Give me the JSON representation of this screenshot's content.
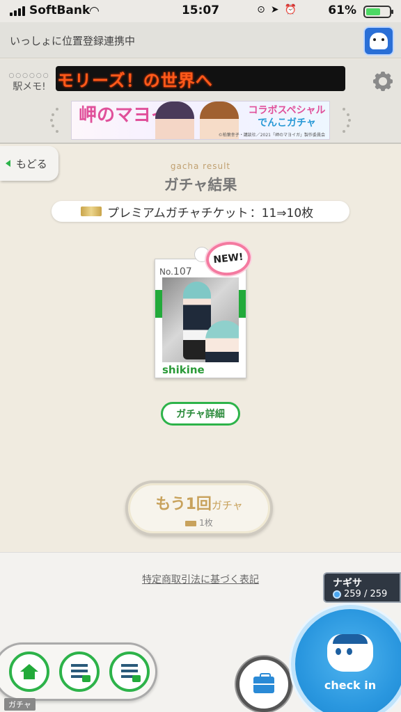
{
  "status": {
    "carrier": "SoftBank",
    "time": "15:07",
    "battery": "61%",
    "battery_level": 0.61
  },
  "linkbar": {
    "text": "いっしょに位置登録連携中"
  },
  "header": {
    "logo": "駅メモ!",
    "logo_sub": "○○○○○○",
    "marquee": "モリーズ！の世界へ"
  },
  "banner": {
    "title": "岬のマヨイガ",
    "collab_line1": "コラボスペシャル",
    "collab_line2": "でんこガチャ",
    "copyright": "©柏葉幸子・講談社／2021「岬のマヨイガ」製作委員会"
  },
  "nav": {
    "back_label": "もどる"
  },
  "result": {
    "subtitle_en": "gacha result",
    "title": "ガチャ結果",
    "ticket_label": "プレミアムガチャチケット",
    "ticket_count": "：11⇒10枚"
  },
  "card": {
    "number_prefix": "No.",
    "number": "107",
    "name": "shikine",
    "new_label": "NEW!"
  },
  "buttons": {
    "detail": "ガチャ詳細",
    "again_main": "もう1回",
    "again_suffix": "ガチャ",
    "again_cost": "1枚"
  },
  "footer": {
    "legal_link": "特定商取引法に基づく表記"
  },
  "station": {
    "name": "ナギサ",
    "count": "259 / 259"
  },
  "checkin": {
    "label": "check in"
  },
  "dock": {
    "current_label": "ガチャ"
  },
  "colors": {
    "accent_green": "#2db34a",
    "checkin_blue": "#2a97df",
    "gold": "#c8a25c"
  }
}
